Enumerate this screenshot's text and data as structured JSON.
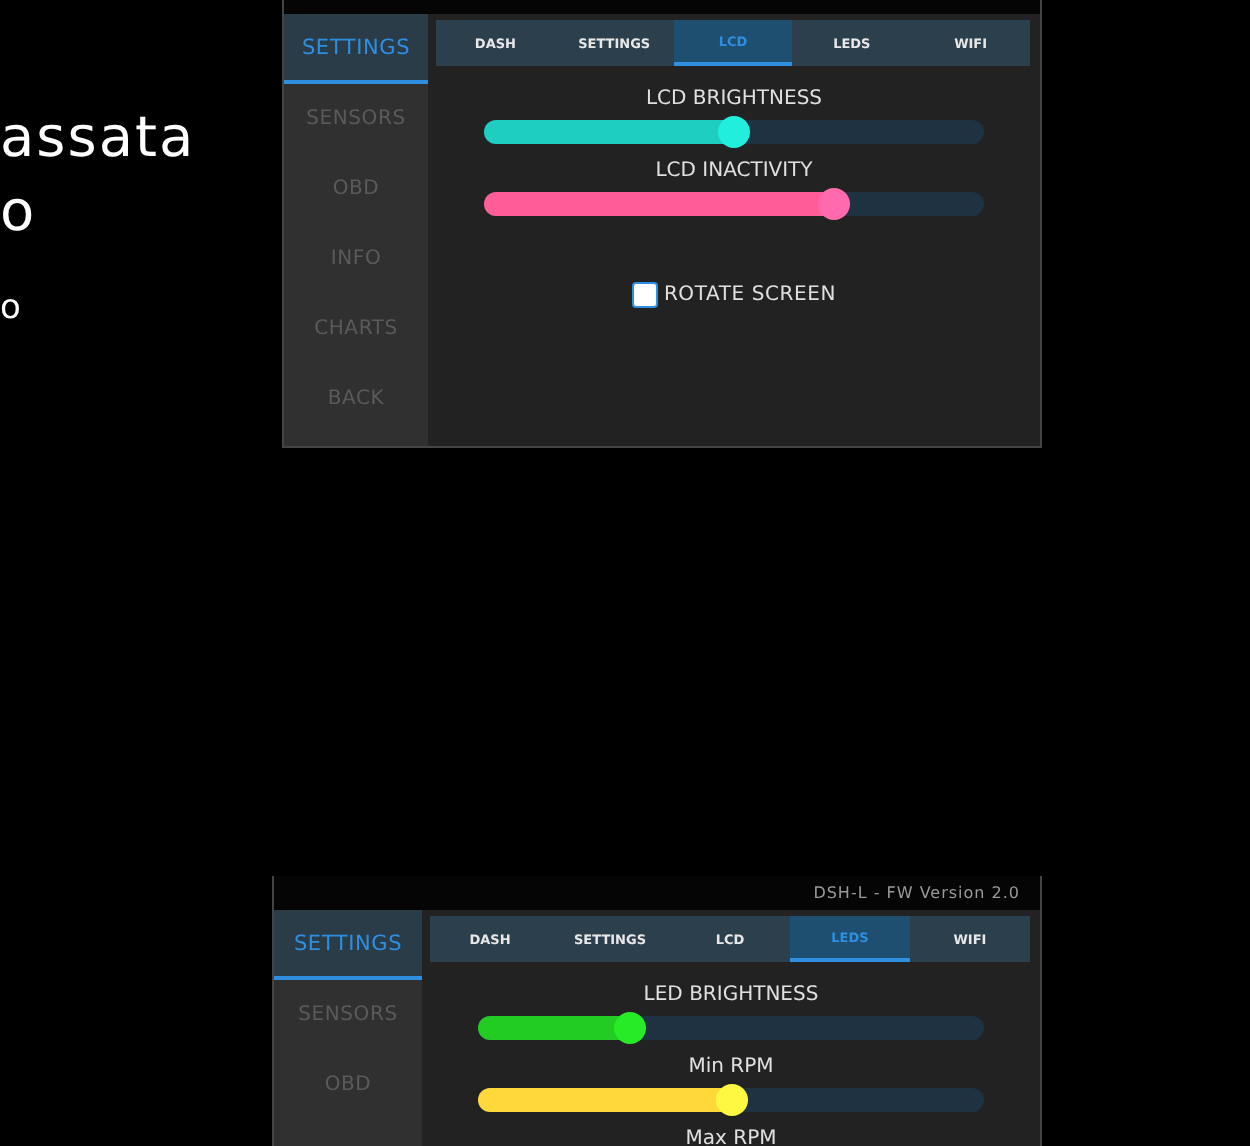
{
  "intro_lines": [
    {
      "text": "assata",
      "kind": "large"
    },
    {
      "text": "o",
      "kind": "large"
    },
    {
      "text": "o",
      "kind": "small"
    }
  ],
  "panels": [
    {
      "sidebar": [
        {
          "label": "SETTINGS",
          "selected": true
        },
        {
          "label": "SENSORS",
          "selected": false
        },
        {
          "label": "OBD",
          "selected": false
        },
        {
          "label": "INFO",
          "selected": false
        },
        {
          "label": "CHARTS",
          "selected": false
        },
        {
          "label": "BACK",
          "selected": false
        }
      ],
      "tabs": [
        {
          "label": "DASH",
          "selected": false
        },
        {
          "label": "SETTINGS",
          "selected": false
        },
        {
          "label": "LCD",
          "selected": true
        },
        {
          "label": "LEDS",
          "selected": false
        },
        {
          "label": "WIFI",
          "selected": false
        }
      ],
      "controls": [
        {
          "kind": "slider",
          "label": "LCD BRIGHTNESS",
          "level": 0.5,
          "color": "#1ecfc0"
        },
        {
          "kind": "slider",
          "label": "LCD INACTIVITY",
          "level": 0.7,
          "color": "#ff5c98"
        },
        {
          "kind": "checkbox",
          "label": "ROTATE SCREEN",
          "checked": false
        }
      ]
    },
    {
      "version": "DSH-L - FW Version 2.0",
      "sidebar": [
        {
          "label": "SETTINGS",
          "selected": true
        },
        {
          "label": "SENSORS",
          "selected": false
        },
        {
          "label": "OBD",
          "selected": false
        }
      ],
      "tabs": [
        {
          "label": "DASH",
          "selected": false
        },
        {
          "label": "SETTINGS",
          "selected": false
        },
        {
          "label": "LCD",
          "selected": false
        },
        {
          "label": "LEDS",
          "selected": true
        },
        {
          "label": "WIFI",
          "selected": false
        }
      ],
      "controls": [
        {
          "kind": "slider",
          "label": "LED BRIGHTNESS",
          "level": 0.3,
          "color": "#22cc22"
        },
        {
          "kind": "slider",
          "label": "Min RPM",
          "level": 0.5,
          "color": "#ffd83a"
        },
        {
          "kind": "label",
          "label": "Max RPM"
        }
      ]
    }
  ]
}
